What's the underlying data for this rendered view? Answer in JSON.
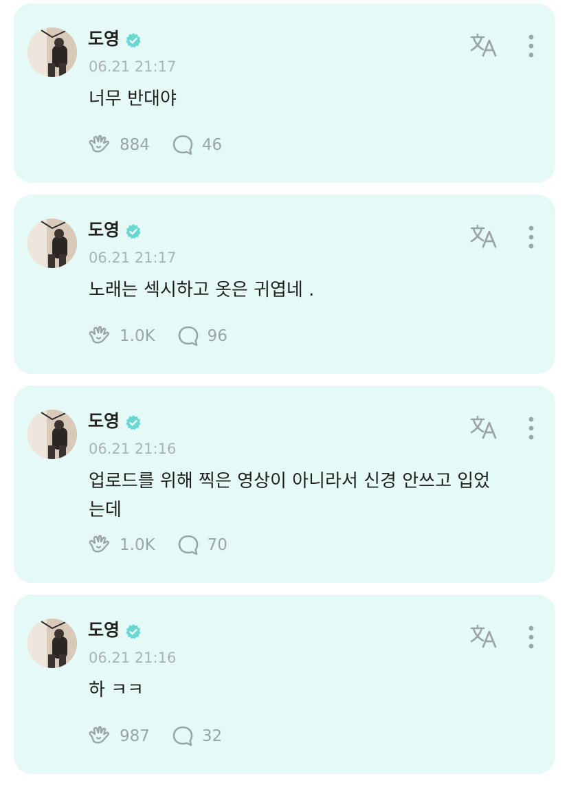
{
  "posts": [
    {
      "author": "도영",
      "timestamp": "06.21 21:17",
      "text": "너무 반대야",
      "likes": "884",
      "comments": "46"
    },
    {
      "author": "도영",
      "timestamp": "06.21 21:17",
      "text": "노래는 섹시하고 옷은 귀엽네 .",
      "likes": "1.0K",
      "comments": "96"
    },
    {
      "author": "도영",
      "timestamp": "06.21 21:16",
      "text": "업로드를 위해 찍은 영상이 아니라서 신경 안쓰고 입었는데",
      "likes": "1.0K",
      "comments": "70"
    },
    {
      "author": "도영",
      "timestamp": "06.21 21:16",
      "text": "하 ㅋㅋ",
      "likes": "987",
      "comments": "32"
    }
  ],
  "icons": {
    "verified": "verified-badge-icon",
    "translate": "translate-icon",
    "more": "more-vertical-icon",
    "like": "like-hand-icon",
    "comment": "comment-bubble-icon"
  },
  "colors": {
    "card_background": "#e5faf6",
    "accent": "#6ad7d3",
    "muted_text": "#a9b3b6",
    "icon_gray": "#9aa5a8"
  }
}
